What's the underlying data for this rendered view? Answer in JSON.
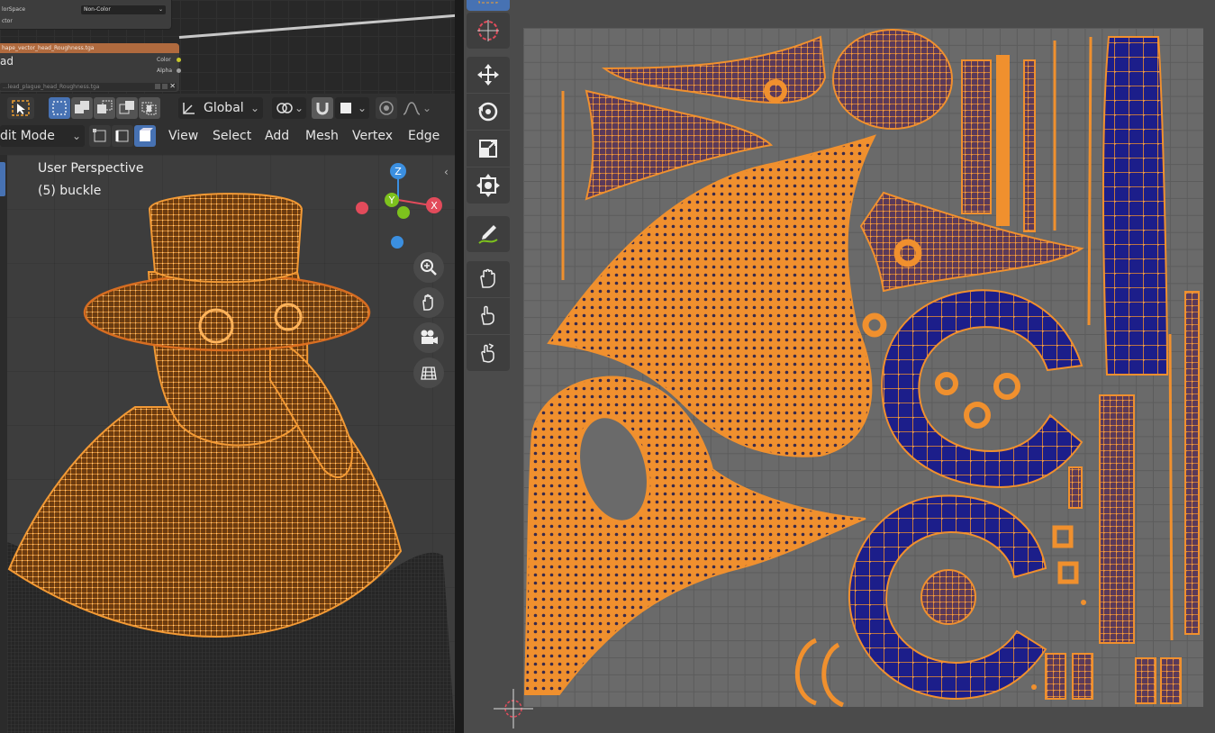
{
  "node_editor": {
    "color_space_label": "lorSpace",
    "color_space_value": "Non-Color",
    "vector_label": "ctor",
    "image_node_title": "hape_vector_head_Roughness.tga",
    "image_node_name": "ad",
    "output_color": "Color",
    "output_alpha": "Alpha",
    "footer_path": "...lead_plague_head_Roughness.tga"
  },
  "viewport_header": {
    "transform_orientation": "Global",
    "mode": "dit Mode",
    "menus": [
      "View",
      "Select",
      "Add",
      "Mesh",
      "Vertex",
      "Edge"
    ]
  },
  "viewport": {
    "view_name": "User Perspective",
    "object_info": "(5) buckle",
    "gizmo_axes": {
      "z": "Z",
      "y": "Y",
      "x": "X"
    },
    "nav_icons": [
      "zoom-icon",
      "hand-pan-icon",
      "camera-icon",
      "grid-ortho-icon"
    ]
  },
  "uv_toolbar": {
    "tools": [
      "select-box-icon",
      "cursor-icon",
      "move-icon",
      "rotate-icon",
      "scale-icon",
      "transform-icon",
      "annotate-icon",
      "grab-icon",
      "relax-icon",
      "pinch-icon"
    ]
  },
  "colors": {
    "selection_orange": "#f0902e",
    "uv_face_blue": "#1c1e8a",
    "active_blue": "#4772b3",
    "axis_x": "#e24b5b",
    "axis_y": "#7dc21d",
    "axis_z": "#3b8fe0"
  }
}
